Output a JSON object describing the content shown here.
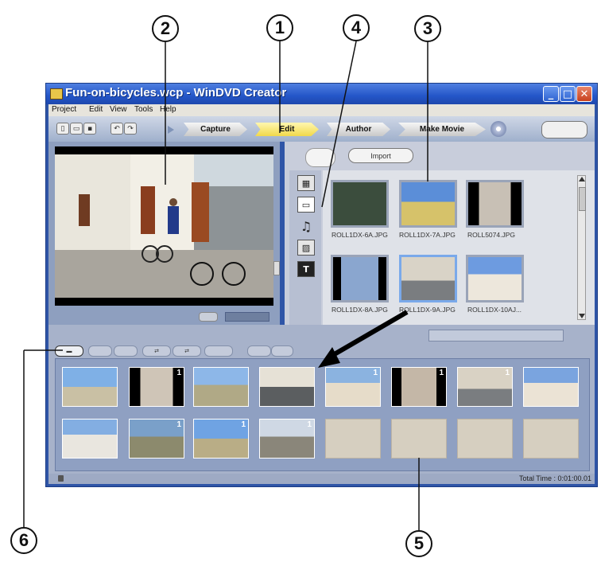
{
  "callouts": [
    "2",
    "1",
    "4",
    "3",
    "6",
    "5"
  ],
  "window": {
    "title": "Fun-on-bicycles.wcp - WinDVD Creator",
    "minimize": "_",
    "maximize": "□",
    "close": "✕"
  },
  "menu": [
    "Project",
    "Edit",
    "View",
    "Tools",
    "Help"
  ],
  "toolbar": {
    "steps": [
      "Capture",
      "Edit",
      "Author",
      "Make Movie"
    ],
    "active_step": "Edit"
  },
  "media": {
    "import_label": "Import",
    "side_tabs": [
      "video-tab-icon",
      "image-tab-icon",
      "audio-tab-icon",
      "transition-tab-icon",
      "title-tab-icon"
    ],
    "thumbnails": [
      "ROLL1DX-6A.JPG",
      "ROLL1DX-7A.JPG",
      "ROLL5074.JPG",
      "ROLL1DX-8A.JPG",
      "ROLL1DX-9A.JPG",
      "ROLL1DX-10AJ..."
    ]
  },
  "storyboard": {
    "clip_badges": [
      "",
      "1",
      "",
      "",
      "1",
      "1",
      "1",
      "",
      "",
      "1",
      "1",
      "1"
    ],
    "total_time": "Total Time : 0:01:00.01"
  }
}
